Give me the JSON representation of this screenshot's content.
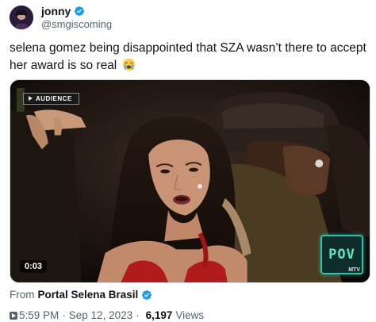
{
  "author": {
    "display_name": "jonny",
    "handle": "@smgiscoming",
    "verified": true
  },
  "tweet": {
    "text": "selena gomez being disappointed that SZA wasn’t there to accept her award is so real",
    "emoji": "loudly-crying-face"
  },
  "media": {
    "badge": "AUDIENCE",
    "duration": "0:03",
    "logo_text": "POV",
    "network_bug": "MTV"
  },
  "source": {
    "prefix": "From",
    "name": "Portal Selena Brasil",
    "verified": true
  },
  "meta": {
    "time": "5:59 PM",
    "separator": "·",
    "date": "Sep 12, 2023",
    "views_count": "6,197",
    "views_label": "Views"
  },
  "colors": {
    "verified_blue": "#1d9bf0",
    "text_primary": "#0f1419",
    "text_secondary": "#536471"
  }
}
